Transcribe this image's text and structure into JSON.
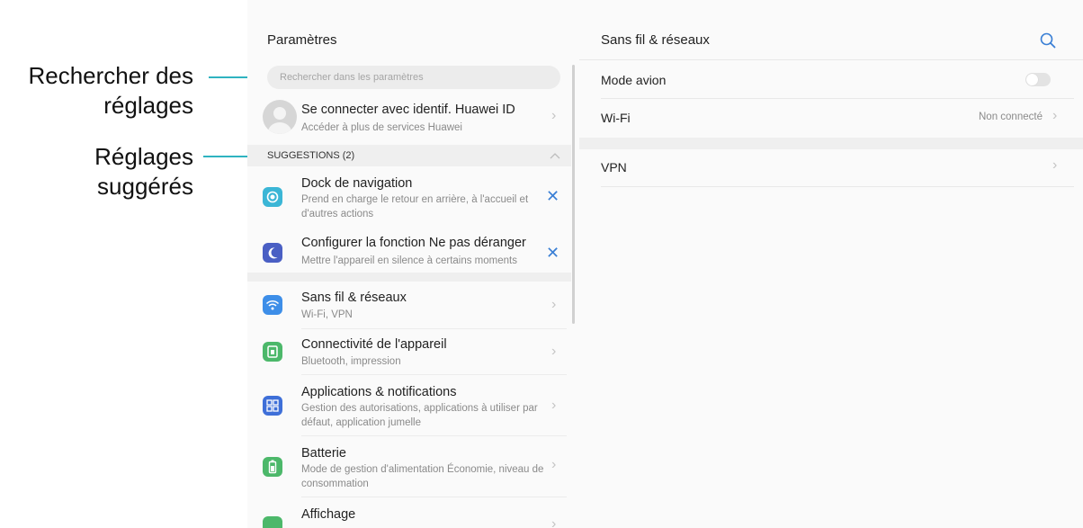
{
  "annotations": {
    "search_label_line1": "Rechercher des",
    "search_label_line2": "réglages",
    "suggested_label_line1": "Réglages",
    "suggested_label_line2": "suggérés"
  },
  "colors": {
    "accent": "#2fb3c0",
    "link_blue": "#3a7fd5"
  },
  "left_panel": {
    "title": "Paramètres",
    "search_placeholder": "Rechercher dans les paramètres",
    "account": {
      "title": "Se connecter avec identif. Huawei ID",
      "subtitle": "Accéder à plus de services Huawei"
    },
    "suggestions_header": "SUGGESTIONS (2)",
    "suggestions": [
      {
        "title": "Dock de navigation",
        "subtitle": "Prend en charge le retour en arrière, à l'accueil et d'autres actions",
        "icon": "navigation-dock-icon",
        "color": "#3bb6d6"
      },
      {
        "title": "Configurer la fonction Ne pas déranger",
        "subtitle": "Mettre l'appareil en silence à certains moments",
        "icon": "moon-icon",
        "color": "#4a5fc4"
      }
    ],
    "items": [
      {
        "title": "Sans fil & réseaux",
        "subtitle": "Wi-Fi, VPN",
        "icon": "wifi-icon",
        "color": "#3d8ee8"
      },
      {
        "title": "Connectivité de l'appareil",
        "subtitle": "Bluetooth, impression",
        "icon": "device-connectivity-icon",
        "color": "#4cb86a"
      },
      {
        "title": "Applications & notifications",
        "subtitle": "Gestion des autorisations, applications à utiliser par défaut, application jumelle",
        "icon": "apps-grid-icon",
        "color": "#3e6fd8"
      },
      {
        "title": "Batterie",
        "subtitle": "Mode de gestion d'alimentation Économie, niveau de consommation",
        "icon": "battery-icon",
        "color": "#4cb86a"
      },
      {
        "title": "Affichage",
        "subtitle": "",
        "icon": "display-icon",
        "color": "#4cb86a"
      }
    ]
  },
  "right_panel": {
    "title": "Sans fil & réseaux",
    "rows": {
      "airplane": {
        "label": "Mode avion"
      },
      "wifi": {
        "label": "Wi-Fi",
        "value": "Non connecté"
      },
      "vpn": {
        "label": "VPN"
      }
    }
  }
}
